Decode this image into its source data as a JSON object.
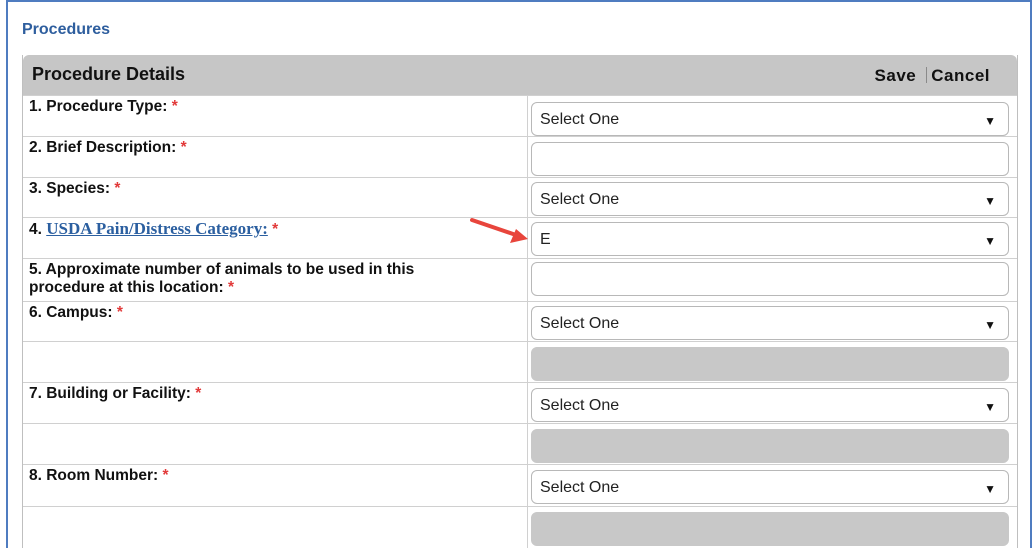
{
  "section_title": "Procedures",
  "panel": {
    "title": "Procedure Details",
    "save_label": "Save",
    "cancel_label": "Cancel"
  },
  "fields": {
    "procedure_type": {
      "label": "1. Procedure Type:",
      "value": "Select One"
    },
    "brief_description": {
      "label": "2. Brief Description:",
      "value": ""
    },
    "species": {
      "label": "3. Species:",
      "value": "Select One"
    },
    "usda": {
      "prefix": "4. ",
      "link": "USDA Pain/Distress Category:",
      "value": "E"
    },
    "animals": {
      "label_line1": "5. Approximate number of animals to be used in this",
      "label_line2": "procedure at this location:",
      "value": ""
    },
    "campus": {
      "label": "6. Campus:",
      "value": "Select One"
    },
    "building": {
      "label": "7. Building or Facility:",
      "value": "Select One"
    },
    "room": {
      "label": "8. Room Number:",
      "value": "Select One"
    }
  },
  "required_marker": "*",
  "colors": {
    "required": "#e23a3a",
    "header_bg": "#c6c6c6",
    "title_blue": "#2e5e9e",
    "arrow": "#e8453c"
  }
}
